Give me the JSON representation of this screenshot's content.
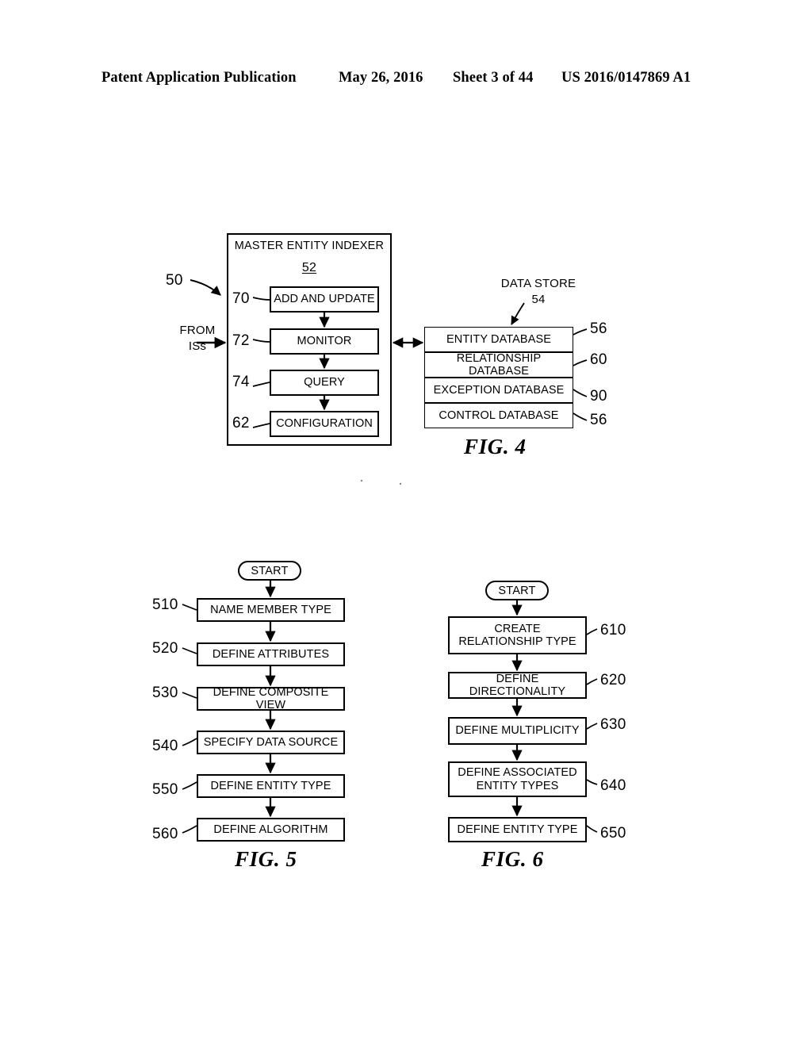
{
  "header": {
    "publication": "Patent Application Publication",
    "date": "May 26, 2016",
    "sheet": "Sheet 3 of 44",
    "patent_number": "US 2016/0147869 A1"
  },
  "fig4": {
    "caption": "FIG. 4",
    "system_ref": "50",
    "input_label_line1": "FROM",
    "input_label_line2": "ISs",
    "indexer": {
      "title": "MASTER ENTITY INDEXER",
      "ref": "52",
      "modules": [
        {
          "ref": "70",
          "label": "ADD AND UPDATE"
        },
        {
          "ref": "72",
          "label": "MONITOR"
        },
        {
          "ref": "74",
          "label": "QUERY"
        },
        {
          "ref": "62",
          "label": "CONFIGURATION"
        }
      ]
    },
    "data_store": {
      "title": "DATA STORE",
      "ref": "54",
      "rows": [
        {
          "label": "ENTITY DATABASE",
          "ref": "56"
        },
        {
          "label": "RELATIONSHIP DATABASE",
          "ref": "60"
        },
        {
          "label": "EXCEPTION DATABASE",
          "ref": "90"
        },
        {
          "label": "CONTROL DATABASE",
          "ref": "56"
        }
      ]
    }
  },
  "fig5": {
    "caption": "FIG. 5",
    "start_label": "START",
    "steps": [
      {
        "ref": "510",
        "label": "NAME MEMBER TYPE"
      },
      {
        "ref": "520",
        "label": "DEFINE ATTRIBUTES"
      },
      {
        "ref": "530",
        "label": "DEFINE COMPOSITE VIEW"
      },
      {
        "ref": "540",
        "label": "SPECIFY DATA SOURCE"
      },
      {
        "ref": "550",
        "label": "DEFINE ENTITY TYPE"
      },
      {
        "ref": "560",
        "label": "DEFINE ALGORITHM"
      }
    ]
  },
  "fig6": {
    "caption": "FIG. 6",
    "start_label": "START",
    "steps": [
      {
        "ref": "610",
        "label": "CREATE\nRELATIONSHIP TYPE"
      },
      {
        "ref": "620",
        "label": "DEFINE DIRECTIONALITY"
      },
      {
        "ref": "630",
        "label": "DEFINE MULTIPLICITY"
      },
      {
        "ref": "640",
        "label": "DEFINE ASSOCIATED\nENTITY TYPES"
      },
      {
        "ref": "650",
        "label": "DEFINE ENTITY TYPE"
      }
    ]
  }
}
